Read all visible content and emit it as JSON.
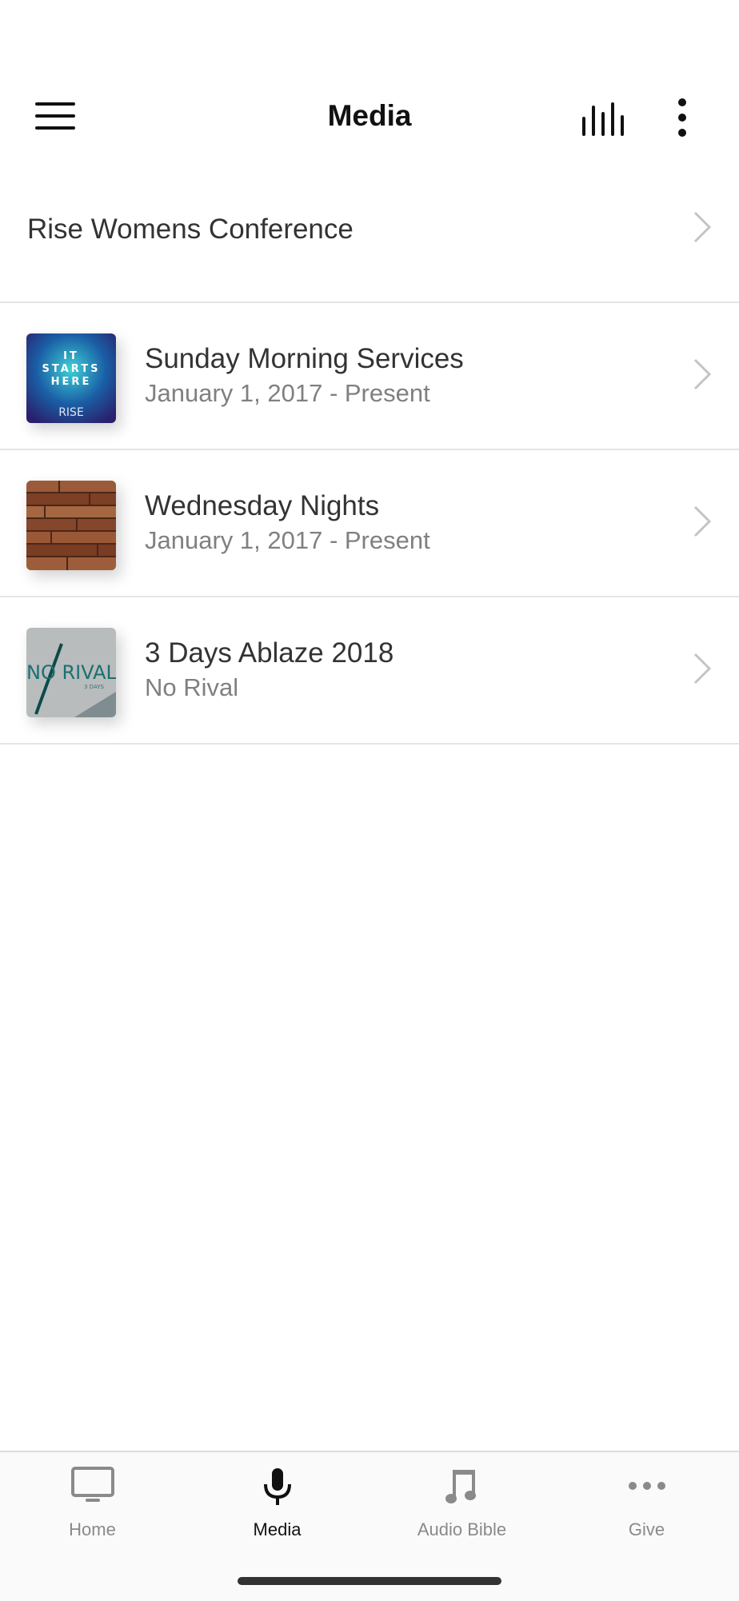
{
  "header": {
    "title": "Media",
    "menu_icon": "hamburger-icon",
    "audio_icon": "audio-bars-icon",
    "more_icon": "vertical-ellipsis-icon"
  },
  "list": {
    "top_item": {
      "label": "Rise Womens Conference"
    },
    "items": [
      {
        "title": "Sunday Morning Services",
        "subtitle": "January 1, 2017 - Present",
        "thumb_text_top": "IT STARTS HERE",
        "thumb_text_bottom": "RISE"
      },
      {
        "title": "Wednesday Nights",
        "subtitle": "January 1, 2017 - Present"
      },
      {
        "title": "3 Days Ablaze 2018",
        "subtitle": "No Rival",
        "thumb_text": "NO RIVAL",
        "thumb_small": "3 DAYS"
      }
    ]
  },
  "tabs": [
    {
      "label": "Home",
      "icon": "tv-icon",
      "active": false
    },
    {
      "label": "Media",
      "icon": "microphone-icon",
      "active": true
    },
    {
      "label": "Audio Bible",
      "icon": "music-note-icon",
      "active": false
    },
    {
      "label": "Give",
      "icon": "ellipsis-icon",
      "active": false
    }
  ],
  "colors": {
    "active_tab": "#111111",
    "inactive_tab": "#8a8a8a",
    "divider": "#e5e5e5"
  }
}
